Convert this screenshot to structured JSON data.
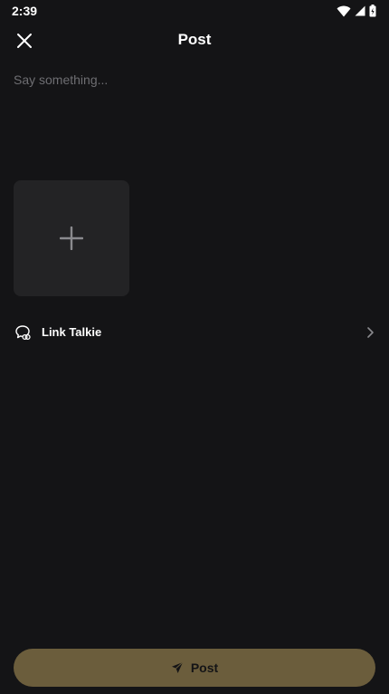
{
  "status_bar": {
    "time": "2:39",
    "icons": [
      "wifi-icon",
      "cell-signal-icon",
      "battery-icon"
    ]
  },
  "header": {
    "title": "Post",
    "close_icon": "close-icon"
  },
  "compose": {
    "placeholder": "Say something...",
    "value": ""
  },
  "media": {
    "add_icon": "plus-icon"
  },
  "link_row": {
    "label": "Link Talkie",
    "icon": "talkie-bubble-icon",
    "chevron": "chevron-right-icon"
  },
  "post_button": {
    "label": "Post",
    "icon": "send-icon"
  },
  "colors": {
    "background": "#141416",
    "tile": "#232325",
    "accent": "#6b5d3c",
    "placeholder": "#6e6e72"
  }
}
